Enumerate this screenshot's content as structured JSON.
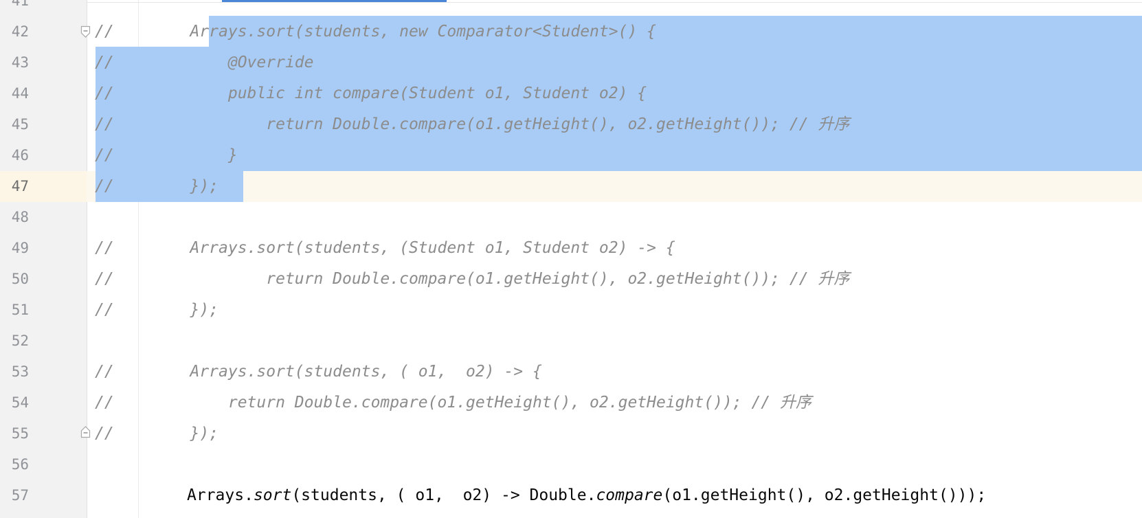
{
  "editor": {
    "lines": [
      {
        "num": "41",
        "code": ""
      },
      {
        "num": "42",
        "code": "//        Arrays.sort(students, new Comparator<Student>() {"
      },
      {
        "num": "43",
        "code": "//            @Override"
      },
      {
        "num": "44",
        "code": "//            public int compare(Student o1, Student o2) {"
      },
      {
        "num": "45",
        "code": "//                return Double.compare(o1.getHeight(), o2.getHeight()); // 升序"
      },
      {
        "num": "46",
        "code": "//            }"
      },
      {
        "num": "47",
        "code": "//        });"
      },
      {
        "num": "48",
        "code": ""
      },
      {
        "num": "49",
        "code": "//        Arrays.sort(students, (Student o1, Student o2) -> {"
      },
      {
        "num": "50",
        "code": "//                return Double.compare(o1.getHeight(), o2.getHeight()); // 升序"
      },
      {
        "num": "51",
        "code": "//        });"
      },
      {
        "num": "52",
        "code": ""
      },
      {
        "num": "53",
        "code": "//        Arrays.sort(students, ( o1,  o2) -> {"
      },
      {
        "num": "54",
        "code": "//            return Double.compare(o1.getHeight(), o2.getHeight()); // 升序"
      },
      {
        "num": "55",
        "code": "//        });"
      },
      {
        "num": "56",
        "code": ""
      },
      {
        "num": "57",
        "code": ""
      }
    ],
    "active_line": {
      "part1": "Arrays.",
      "sort": "sort",
      "part2": "(students, ( o1,  o2) -> Double.",
      "compare": "compare",
      "part3": "(o1.getHeight(), o2.getHeight()));"
    },
    "current_line": "47",
    "colors": {
      "selection": "#a9ccf6",
      "caret_row": "#fdf8ed",
      "comment": "#8c8c8c",
      "code": "#080808",
      "gutter": "#f2f2f2"
    }
  }
}
